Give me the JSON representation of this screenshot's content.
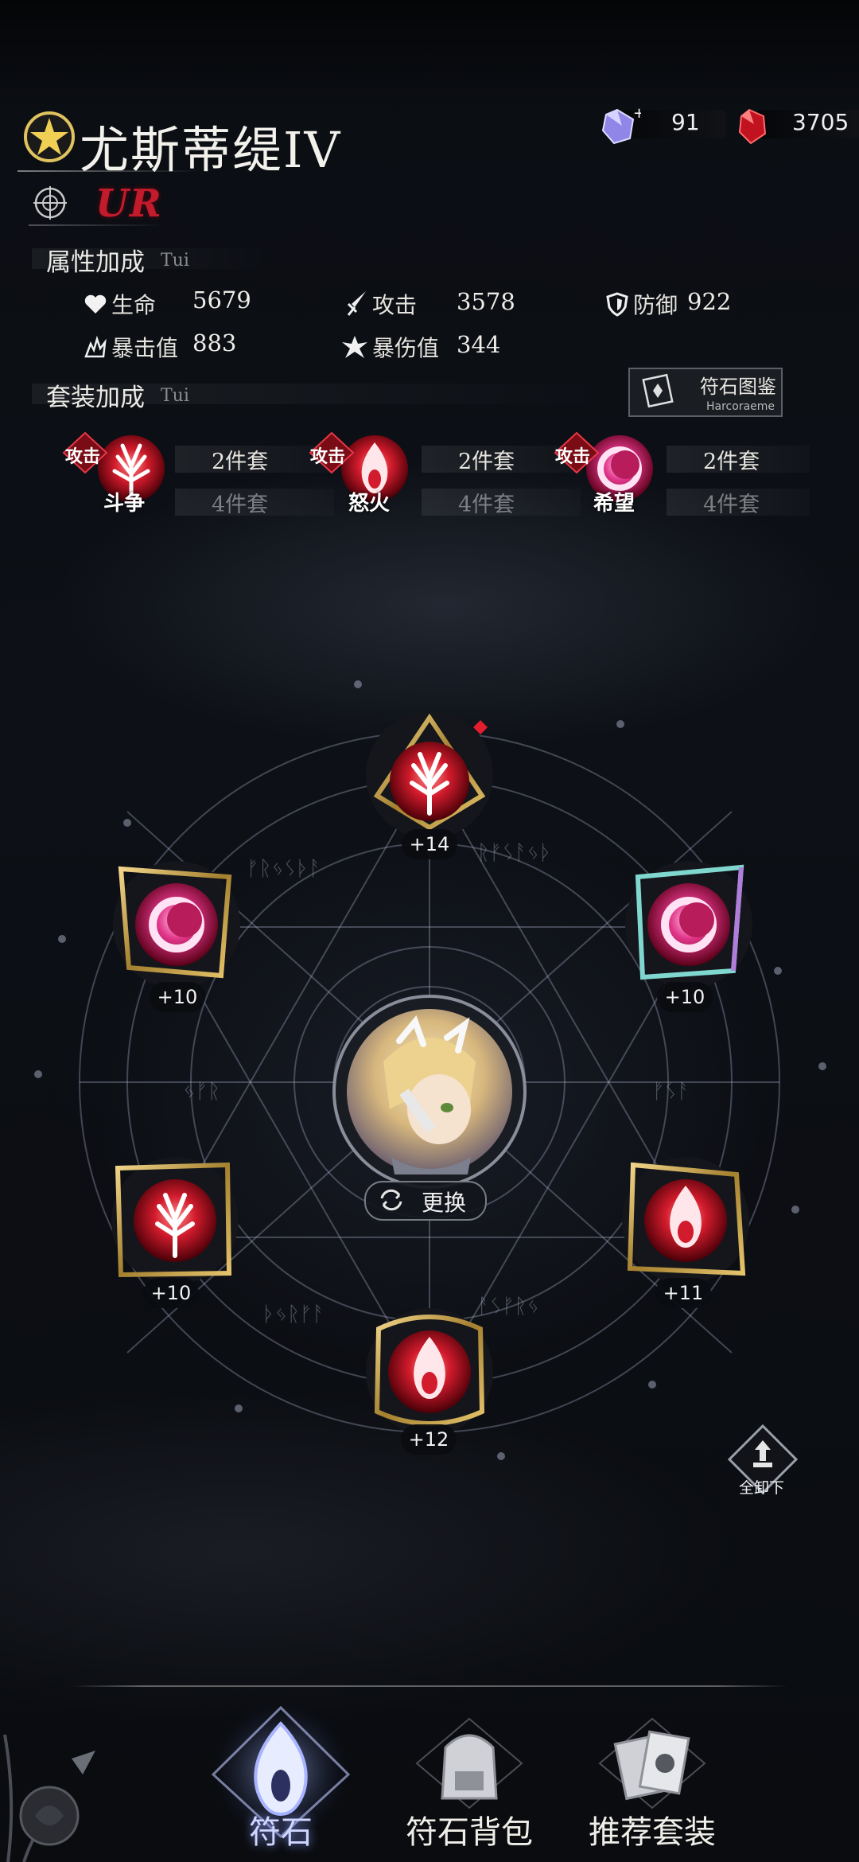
{
  "header": {
    "character_name": "尤斯蒂缇IV",
    "rarity": "UR"
  },
  "currency": [
    {
      "icon": "purple-crystal-icon",
      "value": "91"
    },
    {
      "icon": "red-crystal-icon",
      "value": "3705"
    }
  ],
  "attributes": {
    "title": "属性加成",
    "subtitle": "Tui",
    "stats": [
      {
        "label": "生命",
        "value": "5679",
        "icon": "heart-icon"
      },
      {
        "label": "攻击",
        "value": "3578",
        "icon": "sword-icon"
      },
      {
        "label": "防御",
        "value": "922",
        "icon": "shield-icon"
      },
      {
        "label": "暴击值",
        "value": "883",
        "icon": "crit-icon"
      },
      {
        "label": "暴伤值",
        "value": "344",
        "icon": "crit-damage-icon"
      }
    ]
  },
  "sets": {
    "title": "套装加成",
    "subtitle": "Tui",
    "atlas_label": "符石图鉴",
    "atlas_sub": "Harcoraeme",
    "items": [
      {
        "tag": "攻击",
        "name": "斗争",
        "two": "2件套",
        "four": "4件套",
        "icon": "tree-rune-icon"
      },
      {
        "tag": "攻击",
        "name": "怒火",
        "two": "2件套",
        "four": "4件套",
        "icon": "flame-rune-icon"
      },
      {
        "tag": "攻击",
        "name": "希望",
        "two": "2件套",
        "four": "4件套",
        "icon": "crescent-rune-icon"
      }
    ]
  },
  "slots": [
    {
      "level": "+14",
      "icon": "tree-rune-icon"
    },
    {
      "level": "+10",
      "icon": "crescent-rune-icon"
    },
    {
      "level": "+10",
      "icon": "crescent-rune-icon"
    },
    {
      "level": "+10",
      "icon": "tree-rune-icon"
    },
    {
      "level": "+11",
      "icon": "flame-rune-icon"
    },
    {
      "level": "+12",
      "icon": "flame-rune-icon"
    }
  ],
  "center": {
    "swap_label": "更换"
  },
  "unequip_label": "全卸下",
  "nav": [
    {
      "label": "符石",
      "active": true
    },
    {
      "label": "符石背包",
      "active": false
    },
    {
      "label": "推荐套装",
      "active": false
    }
  ]
}
